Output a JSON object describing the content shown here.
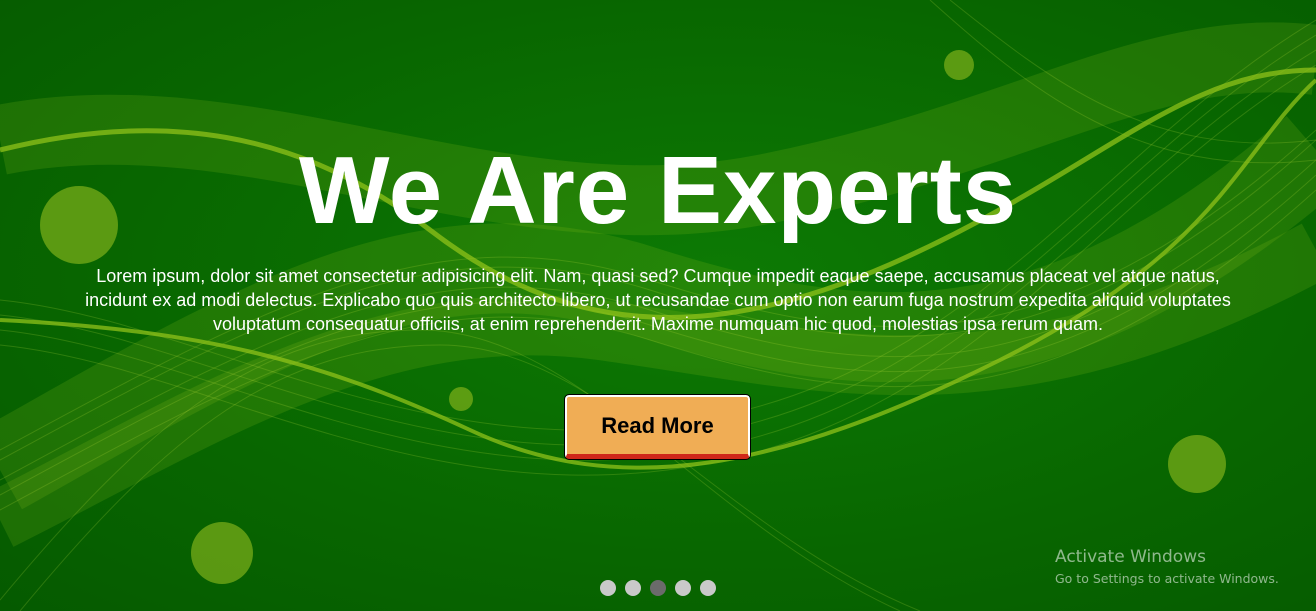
{
  "hero": {
    "title": "We Are Experts",
    "description": "Lorem ipsum, dolor sit amet consectetur adipisicing elit. Nam, quasi sed? Cumque impedit eaque saepe, accusamus placeat vel atque natus, incidunt ex ad modi delectus. Explicabo quo quis architecto libero, ut recusandae cum optio non earum fuga nostrum expedita aliquid voluptates voluptatum consequatur officiis, at enim reprehenderit. Maxime numquam hic quod, molestias ipsa rerum quam.",
    "button_label": "Read More"
  },
  "carousel": {
    "slide_count": 5,
    "active_index": 2
  },
  "watermark": {
    "title": "Activate Windows",
    "subtitle": "Go to Settings to activate Windows."
  },
  "colors": {
    "background": "#086600",
    "accent_wave": "#8fc21a",
    "button": "#f0ad55",
    "button_underline": "#d0261a",
    "dot": "#c9c9c9",
    "dot_active": "#6b6b6b"
  }
}
